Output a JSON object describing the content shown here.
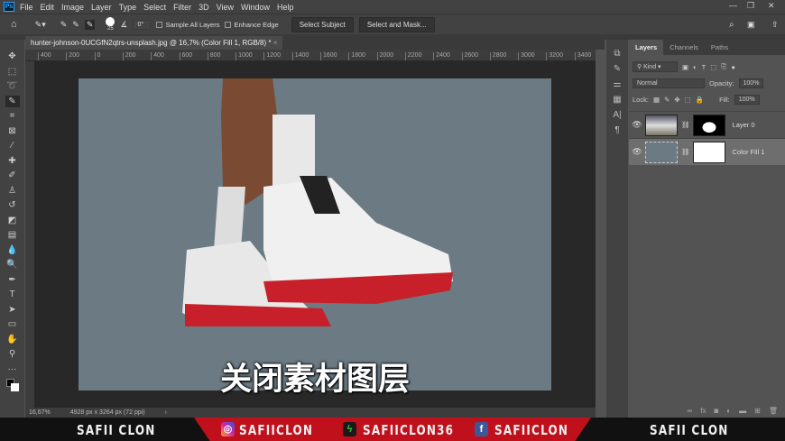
{
  "app": {
    "logo": "Ps",
    "menu": [
      "File",
      "Edit",
      "Image",
      "Layer",
      "Type",
      "Select",
      "Filter",
      "3D",
      "View",
      "Window",
      "Help"
    ]
  },
  "options": {
    "brush_size": "25",
    "angle": "0°",
    "sample_all_layers": "Sample All Layers",
    "enhance_edge": "Enhance Edge",
    "select_subject": "Select Subject",
    "select_and_mask": "Select and Mask..."
  },
  "document": {
    "tab_title": "hunter-johnson-0UCGfN2qtrs-unsplash.jpg @ 16,7% (Color Fill 1, RGB/8) *",
    "ruler": [
      "400",
      "200",
      "0",
      "200",
      "400",
      "600",
      "800",
      "1000",
      "1200",
      "1400",
      "1600",
      "1800",
      "2000",
      "2200",
      "2400",
      "2600",
      "2800",
      "3000",
      "3200",
      "3400",
      "3600"
    ],
    "canvas_color": "#6b7a83",
    "subtitle": "关闭素材图层"
  },
  "status": {
    "zoom": "16,67%",
    "dimensions": "4928 px x 3264 px (72 ppi)"
  },
  "layers_panel": {
    "tabs": [
      "Layers",
      "Channels",
      "Paths"
    ],
    "filter": "Kind",
    "blend_mode": "Normal",
    "opacity_label": "Opacity:",
    "opacity": "100%",
    "lock_label": "Lock:",
    "fill_label": "Fill:",
    "fill": "100%",
    "layers": [
      {
        "name": "Layer 0",
        "visible": true,
        "active": false
      },
      {
        "name": "Color Fill 1",
        "visible": true,
        "active": true
      }
    ]
  },
  "banner": {
    "left": "SAFII CLON",
    "instagram": "SAFIICLON",
    "other": "SAFIICLON36",
    "facebook": "SAFIICLON",
    "right": "SAFII CLON",
    "accent": "#c0101c"
  }
}
